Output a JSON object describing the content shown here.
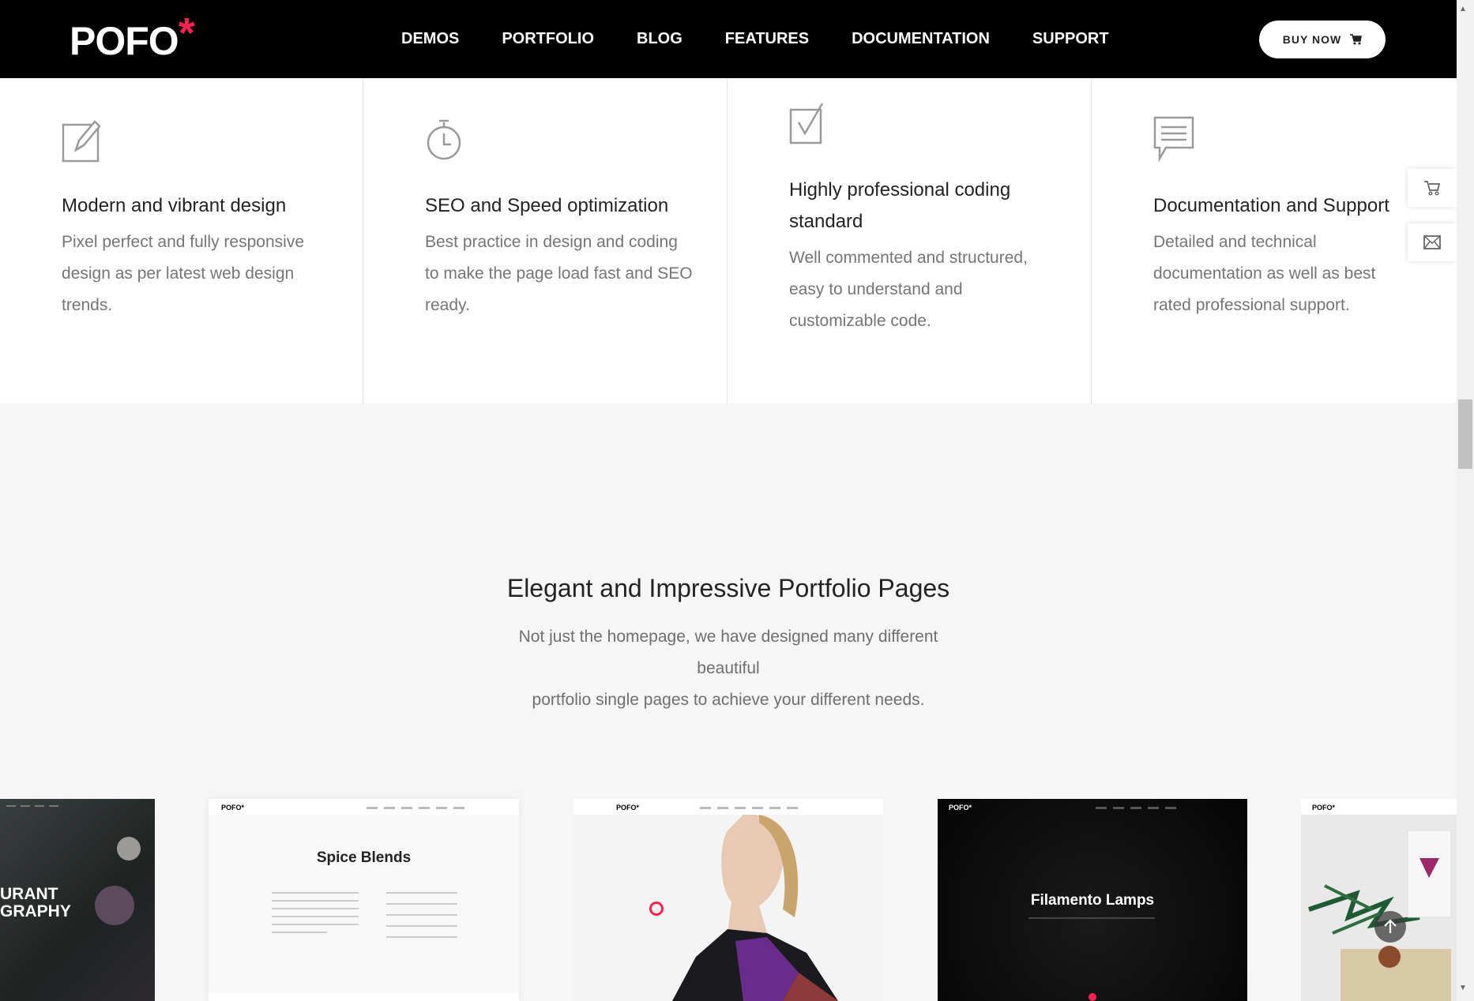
{
  "header": {
    "logo_text": "POFO",
    "logo_mark": "*",
    "nav": [
      "DEMOS",
      "PORTFOLIO",
      "BLOG",
      "FEATURES",
      "DOCUMENTATION",
      "SUPPORT"
    ],
    "buy_label": "BUY NOW",
    "buy_icon": "cart-icon"
  },
  "features": [
    {
      "icon": "edit-icon",
      "title": "Modern and vibrant design",
      "desc": [
        "Pixel perfect and fully responsive",
        "design as per latest web design",
        "trends."
      ]
    },
    {
      "icon": "stopwatch-icon",
      "title": "SEO and Speed optimization",
      "desc": [
        "Best practice in design and coding",
        "to make the page load fast and SEO",
        "ready."
      ]
    },
    {
      "icon": "checkbox-icon",
      "title": [
        "Highly professional coding",
        "standard"
      ],
      "desc": [
        "Well commented and structured,",
        "easy to understand and",
        "customizable code."
      ]
    },
    {
      "icon": "chat-icon",
      "title": "Documentation and Support",
      "desc": [
        "Detailed and technical",
        "documentation as well as best",
        "rated professional support."
      ]
    }
  ],
  "side_buttons": [
    "cart-icon",
    "mail-icon"
  ],
  "portfolio": {
    "title": "Elegant and Impressive Portfolio Pages",
    "desc": [
      "Not just the homepage, we have designed many different beautiful",
      "portfolio single pages to achieve your different needs."
    ]
  },
  "thumbs": [
    {
      "text": [
        "URANT",
        "GRAPHY"
      ],
      "mini_logo": ""
    },
    {
      "text": [
        "Spice Blends"
      ],
      "mini_logo": "POFO*"
    },
    {
      "text": [],
      "mini_logo": "POFO*"
    },
    {
      "text": [
        "Filamento Lamps"
      ],
      "mini_logo": "POFO*"
    },
    {
      "text": [],
      "mini_logo": "POFO*"
    }
  ],
  "colors": {
    "accent": "#ff214f",
    "header_bg": "#000000",
    "section_bg": "#f6f6f6"
  }
}
